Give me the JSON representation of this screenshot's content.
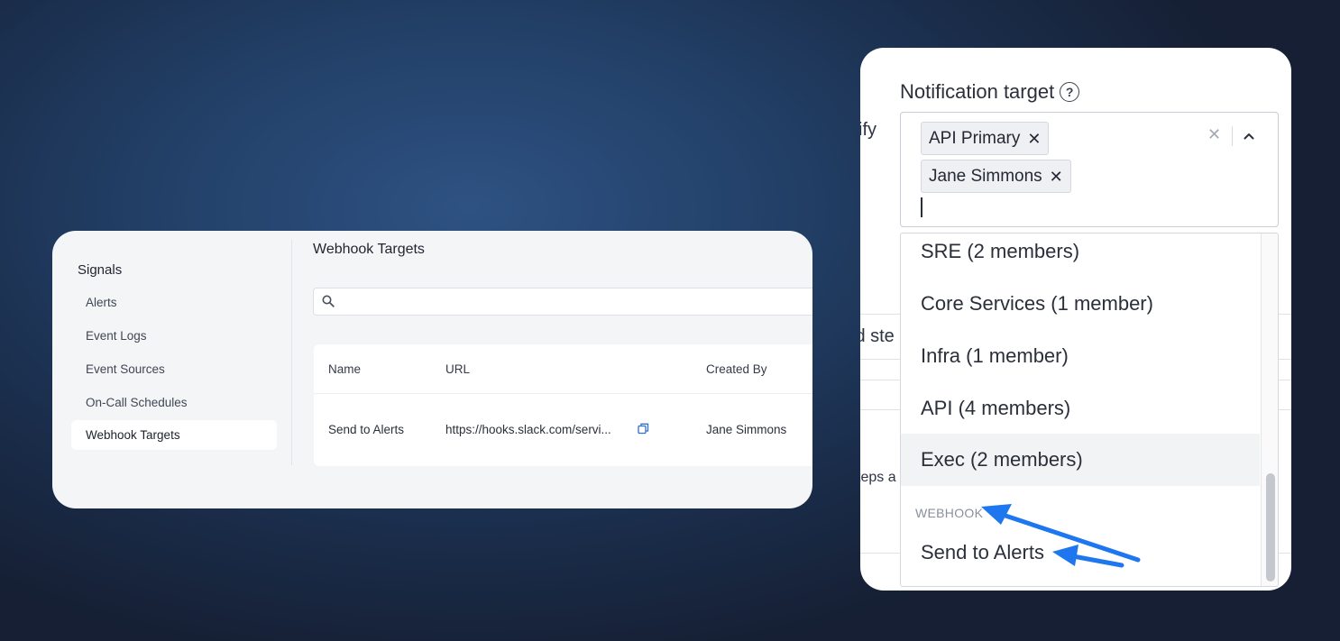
{
  "left_panel": {
    "sidebar": {
      "section_title": "Signals",
      "items": [
        {
          "label": "Alerts"
        },
        {
          "label": "Event Logs"
        },
        {
          "label": "Event Sources"
        },
        {
          "label": "On-Call Schedules"
        },
        {
          "label": "Webhook Targets",
          "active": true
        }
      ]
    },
    "main": {
      "title": "Webhook Targets",
      "search": {
        "placeholder": "",
        "value": ""
      },
      "table": {
        "columns": [
          "Name",
          "URL",
          "Created By"
        ],
        "rows": [
          {
            "name": "Send to Alerts",
            "url": "https://hooks.slack.com/servi...",
            "created_by": "Jane Simmons"
          }
        ]
      }
    }
  },
  "right_panel": {
    "background_peek": {
      "notify_fragment": "ify",
      "add_step_fragment": "ld ste",
      "steps_fragment": "teps a"
    },
    "field": {
      "label": "Notification target",
      "help_icon": "?",
      "selected_chips": [
        {
          "label": "API Primary"
        },
        {
          "label": "Jane Simmons"
        }
      ],
      "clear_glyph": "✕",
      "chip_remove_glyph": "✕"
    },
    "dropdown": {
      "options": [
        {
          "label": "SRE (2 members)"
        },
        {
          "label": "Core Services (1 member)"
        },
        {
          "label": "Infra (1 member)"
        },
        {
          "label": "API (4 members)"
        },
        {
          "label": "Exec (2 members)",
          "highlighted": true
        }
      ],
      "groups": [
        {
          "label": "WEBHOOK",
          "options": [
            {
              "label": "Send to Alerts"
            }
          ]
        }
      ]
    }
  },
  "annotation": {
    "arrow_color": "#1a73e8"
  }
}
